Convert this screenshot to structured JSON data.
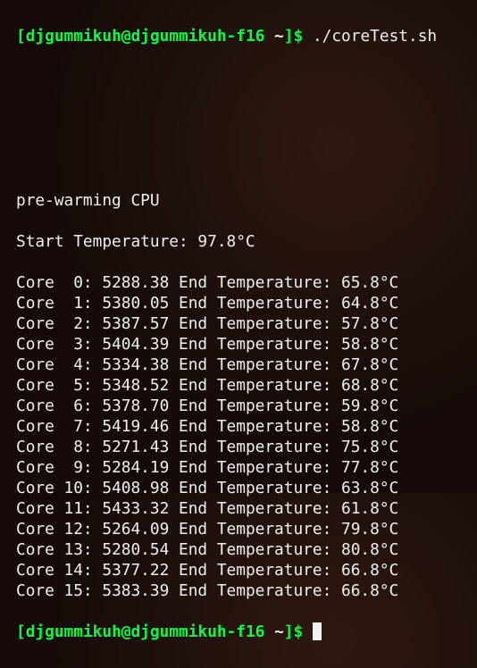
{
  "prompt": {
    "open": "[",
    "user_host": "djgummikuh@djgummikuh-f16",
    "space": " ",
    "tilde": "~",
    "close": "]",
    "dollar": "$"
  },
  "command": " ./coreTest.sh",
  "prewarm": "pre-warming CPU",
  "start_temp_label": "Start Temperature: ",
  "start_temp_value": "97.8°C",
  "cores": [
    {
      "label": "Core  0: ",
      "freq": "5288.38",
      "end_label": " End Temperature: ",
      "temp": "65.8°C"
    },
    {
      "label": "Core  1: ",
      "freq": "5380.05",
      "end_label": " End Temperature: ",
      "temp": "64.8°C"
    },
    {
      "label": "Core  2: ",
      "freq": "5387.57",
      "end_label": " End Temperature: ",
      "temp": "57.8°C"
    },
    {
      "label": "Core  3: ",
      "freq": "5404.39",
      "end_label": " End Temperature: ",
      "temp": "58.8°C"
    },
    {
      "label": "Core  4: ",
      "freq": "5334.38",
      "end_label": " End Temperature: ",
      "temp": "67.8°C"
    },
    {
      "label": "Core  5: ",
      "freq": "5348.52",
      "end_label": " End Temperature: ",
      "temp": "68.8°C"
    },
    {
      "label": "Core  6: ",
      "freq": "5378.70",
      "end_label": " End Temperature: ",
      "temp": "59.8°C"
    },
    {
      "label": "Core  7: ",
      "freq": "5419.46",
      "end_label": " End Temperature: ",
      "temp": "58.8°C"
    },
    {
      "label": "Core  8: ",
      "freq": "5271.43",
      "end_label": " End Temperature: ",
      "temp": "75.8°C"
    },
    {
      "label": "Core  9: ",
      "freq": "5284.19",
      "end_label": " End Temperature: ",
      "temp": "77.8°C"
    },
    {
      "label": "Core 10: ",
      "freq": "5408.98",
      "end_label": " End Temperature: ",
      "temp": "63.8°C"
    },
    {
      "label": "Core 11: ",
      "freq": "5433.32",
      "end_label": " End Temperature: ",
      "temp": "61.8°C"
    },
    {
      "label": "Core 12: ",
      "freq": "5264.09",
      "end_label": " End Temperature: ",
      "temp": "79.8°C"
    },
    {
      "label": "Core 13: ",
      "freq": "5280.54",
      "end_label": " End Temperature: ",
      "temp": "80.8°C"
    },
    {
      "label": "Core 14: ",
      "freq": "5377.22",
      "end_label": " End Temperature: ",
      "temp": "66.8°C"
    },
    {
      "label": "Core 15: ",
      "freq": "5383.39",
      "end_label": " End Temperature: ",
      "temp": "66.8°C"
    }
  ]
}
